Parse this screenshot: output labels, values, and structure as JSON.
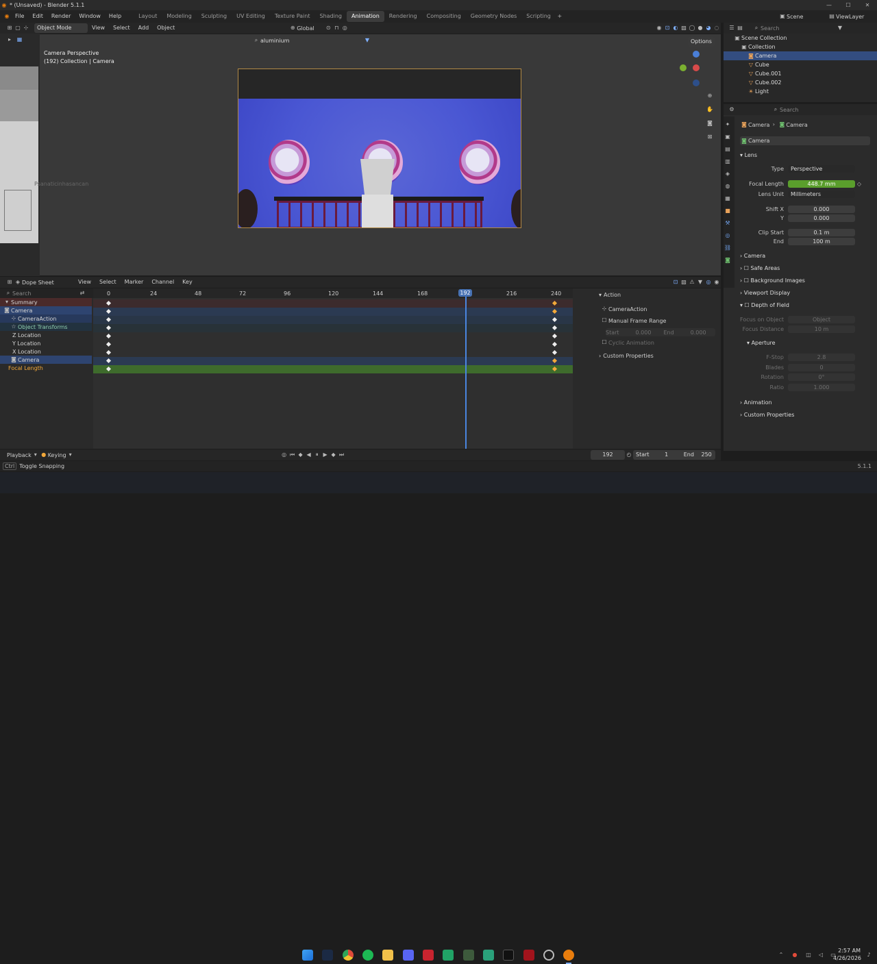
{
  "window": {
    "title": "* (Unsaved) - Blender 5.1.1"
  },
  "menu": [
    "File",
    "Edit",
    "Render",
    "Window",
    "Help"
  ],
  "workspaces": [
    "Layout",
    "Modeling",
    "Sculpting",
    "UV Editing",
    "Texture Paint",
    "Shading",
    "Animation",
    "Rendering",
    "Compositing",
    "Geometry Nodes",
    "Scripting"
  ],
  "active_workspace": "Animation",
  "scene": {
    "label": "Scene",
    "viewlayer": "ViewLayer"
  },
  "header3d": {
    "mode": "Object Mode",
    "view": "View",
    "select": "Select",
    "add": "Add",
    "object": "Object",
    "orientation": "Global",
    "options": "Options",
    "search_value": "aluminium"
  },
  "overlay_text": {
    "line1": "Camera Perspective",
    "line2": "(192) Collection | Camera"
  },
  "side_preview_label": "Psanaticinhasancan",
  "outliner": {
    "search_placeholder": "Search",
    "items": [
      {
        "label": "Scene Collection"
      },
      {
        "label": "Collection"
      },
      {
        "label": "Camera"
      },
      {
        "label": "Cube"
      },
      {
        "label": "Cube.001"
      },
      {
        "label": "Cube.002"
      },
      {
        "label": "Light"
      }
    ]
  },
  "properties": {
    "search_placeholder": "Search",
    "breadcrumb": [
      "Camera",
      "Camera"
    ],
    "datablock": "Camera",
    "lens_panel": "Lens",
    "type_label": "Type",
    "type_value": "Perspective",
    "focal_label": "Focal Length",
    "focal_value": "448.7 mm",
    "lens_unit_label": "Lens Unit",
    "lens_unit_value": "Millimeters",
    "shiftx_label": "Shift X",
    "shiftx_value": "0.000",
    "shifty_label": "Y",
    "shifty_value": "0.000",
    "clip_start_label": "Clip Start",
    "clip_start_value": "0.1 m",
    "clip_end_label": "End",
    "clip_end_value": "100 m",
    "panels": [
      "Camera",
      "Safe Areas",
      "Background Images",
      "Viewport Display",
      "Depth of Field"
    ],
    "focus_object_label": "Focus on Object",
    "focus_object_placeholder": "Object",
    "focus_distance_label": "Focus Distance",
    "focus_distance_value": "10 m",
    "aperture_label": "Aperture",
    "fstop_label": "F-Stop",
    "fstop_value": "2.8",
    "blades_label": "Blades",
    "blades_value": "0",
    "rotation_label": "Rotation",
    "rotation_value": "0°",
    "ratio_label": "Ratio",
    "ratio_value": "1.000",
    "animation_panel": "Animation",
    "custom_props_panel": "Custom Properties"
  },
  "dopesheet": {
    "editor": "Dope Sheet",
    "view": "View",
    "select": "Select",
    "marker": "Marker",
    "channel": "Channel",
    "key": "Key",
    "search_placeholder": "Search",
    "ticks": [
      "0",
      "24",
      "48",
      "72",
      "96",
      "120",
      "144",
      "168",
      "192",
      "216",
      "240"
    ],
    "current_frame": "192",
    "channels": [
      {
        "label": "Summary"
      },
      {
        "label": "Camera"
      },
      {
        "label": "CameraAction"
      },
      {
        "label": "Object Transforms"
      },
      {
        "label": "Z Location"
      },
      {
        "label": "Y Location"
      },
      {
        "label": "X Location"
      },
      {
        "label": "Camera"
      },
      {
        "label": "Focal Length"
      }
    ],
    "action_panel": {
      "title": "Action",
      "action_name": "CameraAction",
      "manual_range": "Manual Frame Range",
      "start_label": "Start",
      "start_value": "0.000",
      "end_label": "End",
      "end_value": "0.000",
      "cyclic": "Cyclic Animation",
      "custom_props": "Custom Properties"
    }
  },
  "timeline": {
    "playback": "Playback",
    "keying": "Keying",
    "frame": "192",
    "start_label": "Start",
    "start_value": "1",
    "end_label": "End",
    "end_value": "250"
  },
  "status": {
    "key": "Ctrl",
    "text": "Toggle Snapping",
    "version": "5.1.1"
  },
  "taskbar": {
    "time": "2:57 AM",
    "date": "4/26/2026"
  },
  "colors": {
    "accent": "#4772b3",
    "keyframe": "#f2a83a",
    "focal_green": "#5a9e2c"
  }
}
